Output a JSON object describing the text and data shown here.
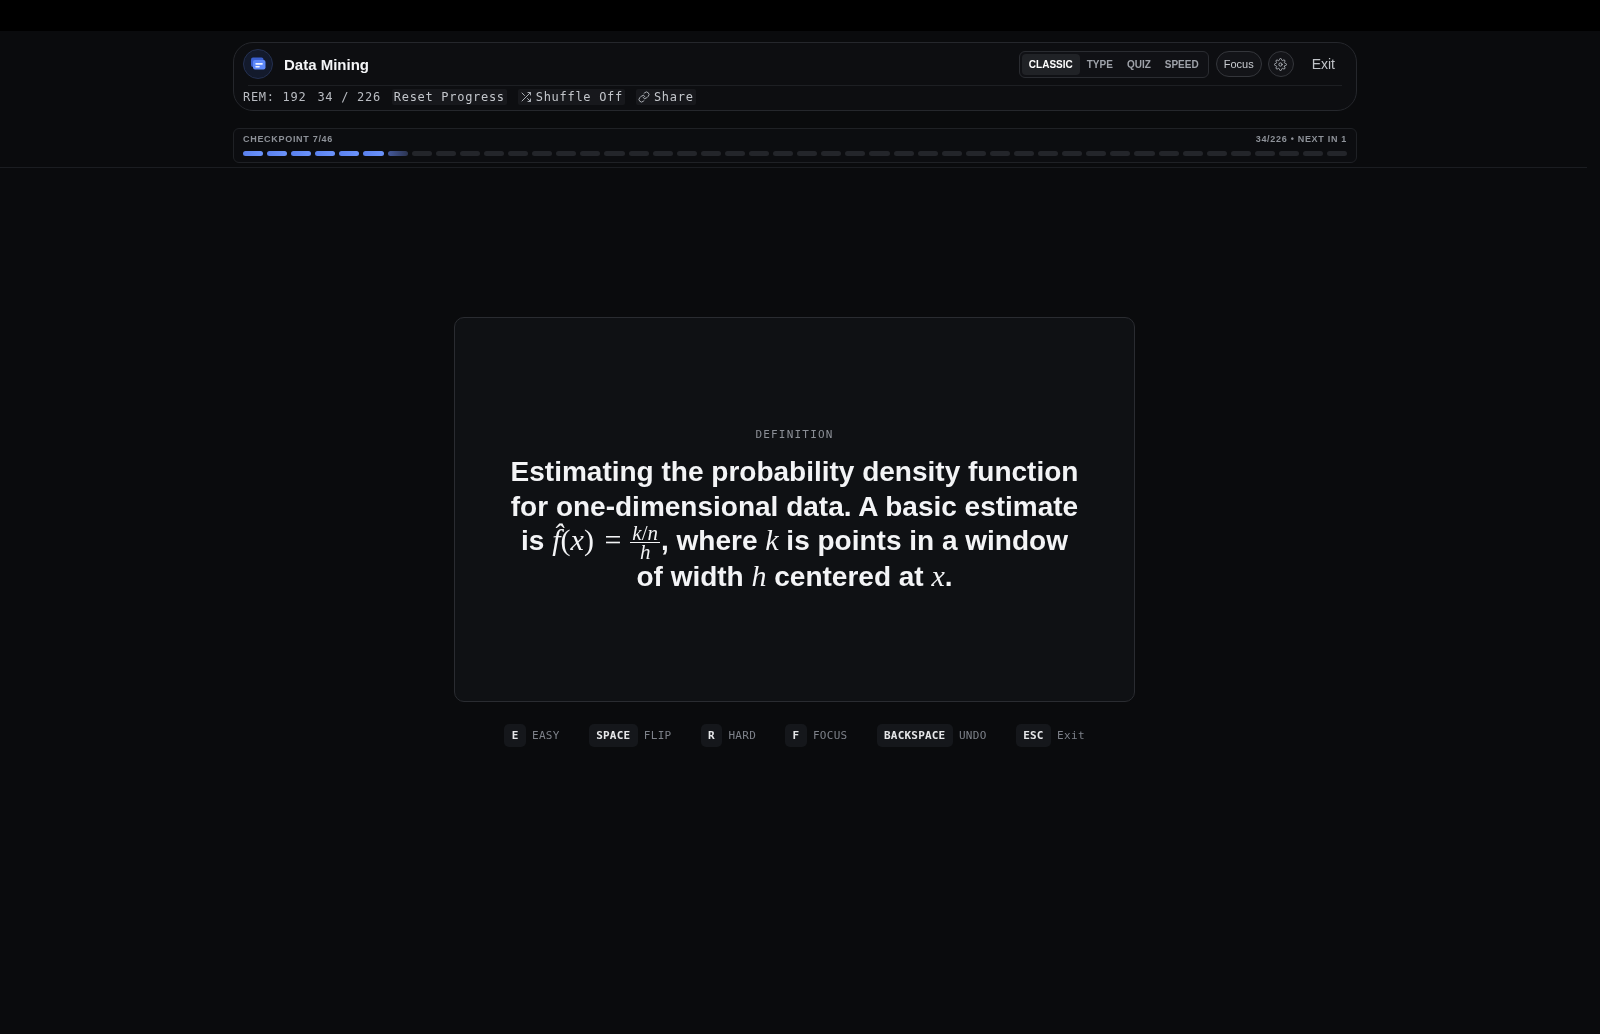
{
  "deck": {
    "title": "Data Mining",
    "remaining": "REM: 192",
    "count": "34 / 226",
    "actions": [
      {
        "kind": "reset",
        "label": "Reset Progress"
      },
      {
        "kind": "shuffle",
        "label": "Shuffle Off"
      },
      {
        "kind": "share",
        "label": "Share"
      }
    ]
  },
  "modes": [
    {
      "label": "CLASSIC",
      "selected": true
    },
    {
      "label": "TYPE",
      "selected": false
    },
    {
      "label": "QUIZ",
      "selected": false
    },
    {
      "label": "SPEED",
      "selected": false
    }
  ],
  "focus_button": "Focus",
  "exit_button": "Exit",
  "progress": {
    "label": "CHECKPOINT 7/46",
    "summary": "34/226 • NEXT IN 1",
    "segments": [
      {
        "done": true,
        "current": false
      },
      {
        "done": true,
        "current": false
      },
      {
        "done": true,
        "current": false
      },
      {
        "done": true,
        "current": false
      },
      {
        "done": true,
        "current": false
      },
      {
        "done": true,
        "current": false
      },
      {
        "done": false,
        "current": true
      },
      {
        "done": false,
        "current": false
      },
      {
        "done": false,
        "current": false
      },
      {
        "done": false,
        "current": false
      },
      {
        "done": false,
        "current": false
      },
      {
        "done": false,
        "current": false
      },
      {
        "done": false,
        "current": false
      },
      {
        "done": false,
        "current": false
      },
      {
        "done": false,
        "current": false
      },
      {
        "done": false,
        "current": false
      },
      {
        "done": false,
        "current": false
      },
      {
        "done": false,
        "current": false
      },
      {
        "done": false,
        "current": false
      },
      {
        "done": false,
        "current": false
      },
      {
        "done": false,
        "current": false
      },
      {
        "done": false,
        "current": false
      },
      {
        "done": false,
        "current": false
      },
      {
        "done": false,
        "current": false
      },
      {
        "done": false,
        "current": false
      },
      {
        "done": false,
        "current": false
      },
      {
        "done": false,
        "current": false
      },
      {
        "done": false,
        "current": false
      },
      {
        "done": false,
        "current": false
      },
      {
        "done": false,
        "current": false
      },
      {
        "done": false,
        "current": false
      },
      {
        "done": false,
        "current": false
      },
      {
        "done": false,
        "current": false
      },
      {
        "done": false,
        "current": false
      },
      {
        "done": false,
        "current": false
      },
      {
        "done": false,
        "current": false
      },
      {
        "done": false,
        "current": false
      },
      {
        "done": false,
        "current": false
      },
      {
        "done": false,
        "current": false
      },
      {
        "done": false,
        "current": false
      },
      {
        "done": false,
        "current": false
      },
      {
        "done": false,
        "current": false
      },
      {
        "done": false,
        "current": false
      },
      {
        "done": false,
        "current": false
      },
      {
        "done": false,
        "current": false
      },
      {
        "done": false,
        "current": false
      }
    ]
  },
  "card": {
    "label": "DEFINITION",
    "body": [
      {
        "kind": "text",
        "text": "Estimating the probability density function for one-dimensional data. A basic estimate is "
      },
      {
        "kind": "math",
        "text": "*f̂*(*x*) ="
      },
      {
        "kind": "fraction",
        "numerator": "*k*/*n*",
        "denominator": "*h*"
      },
      {
        "kind": "text",
        "text": ", where "
      },
      {
        "kind": "math",
        "text": "*k*"
      },
      {
        "kind": "text",
        "text": " is points in a window of width "
      },
      {
        "kind": "math",
        "text": "*h*"
      },
      {
        "kind": "text",
        "text": " centered at "
      },
      {
        "kind": "math",
        "text": "*x*"
      },
      {
        "kind": "text",
        "text": "."
      }
    ]
  },
  "shortcuts": [
    {
      "key": "E",
      "label": "EASY"
    },
    {
      "key": "SPACE",
      "label": "FLIP"
    },
    {
      "key": "R",
      "label": "HARD"
    },
    {
      "key": "F",
      "label": "FOCUS"
    },
    {
      "key": "BACKSPACE",
      "label": "UNDO"
    },
    {
      "key": "ESC",
      "label": "Exit"
    }
  ]
}
